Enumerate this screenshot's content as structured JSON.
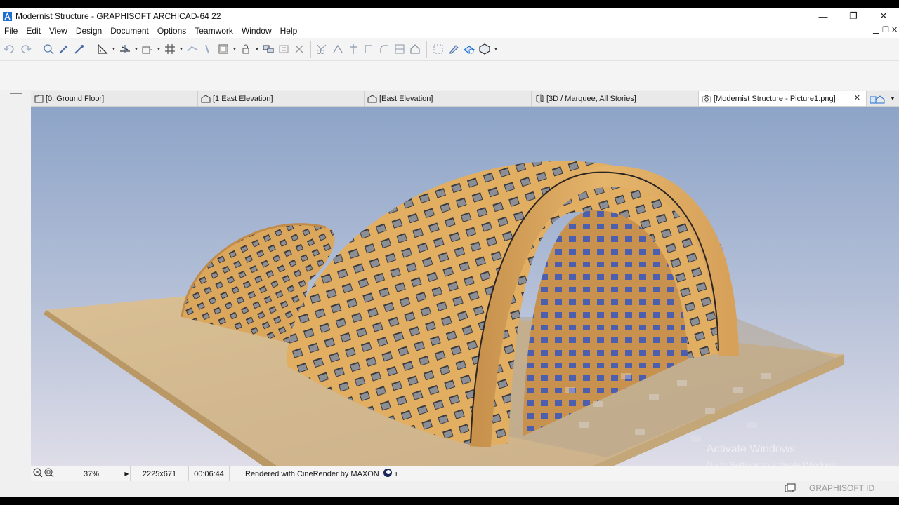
{
  "window": {
    "title": "Modernist Structure - GRAPHISOFT ARCHICAD-64 22",
    "controls": [
      "—",
      "❐",
      "✕"
    ]
  },
  "menu": [
    "File",
    "Edit",
    "View",
    "Design",
    "Document",
    "Options",
    "Teamwork",
    "Window",
    "Help"
  ],
  "mdi_controls": [
    "▁",
    "❐",
    "✕"
  ],
  "tabs": [
    {
      "label": "[0. Ground Floor]"
    },
    {
      "label": "[1 East Elevation]"
    },
    {
      "label": "[East Elevation]"
    },
    {
      "label": "[3D / Marquee, All Stories]"
    },
    {
      "label": "[Modernist Structure - Picture1.png]",
      "close": "✕"
    }
  ],
  "status": {
    "zoom": "37%",
    "size": "2225x671",
    "time": "00:06:44",
    "renderer": "Rendered with CineRender by MAXON",
    "info": "i"
  },
  "watermark": {
    "line1": "Activate Windows",
    "line2": "Go to Settings to activate Windows."
  },
  "footer": {
    "graphisoft_id": "GRAPHISOFT ID"
  },
  "colors": {
    "accent": "#1f6fd1",
    "wood": "#d9a65c",
    "sky_top": "#8da4c8",
    "sky_bottom": "#d9d9e6"
  }
}
